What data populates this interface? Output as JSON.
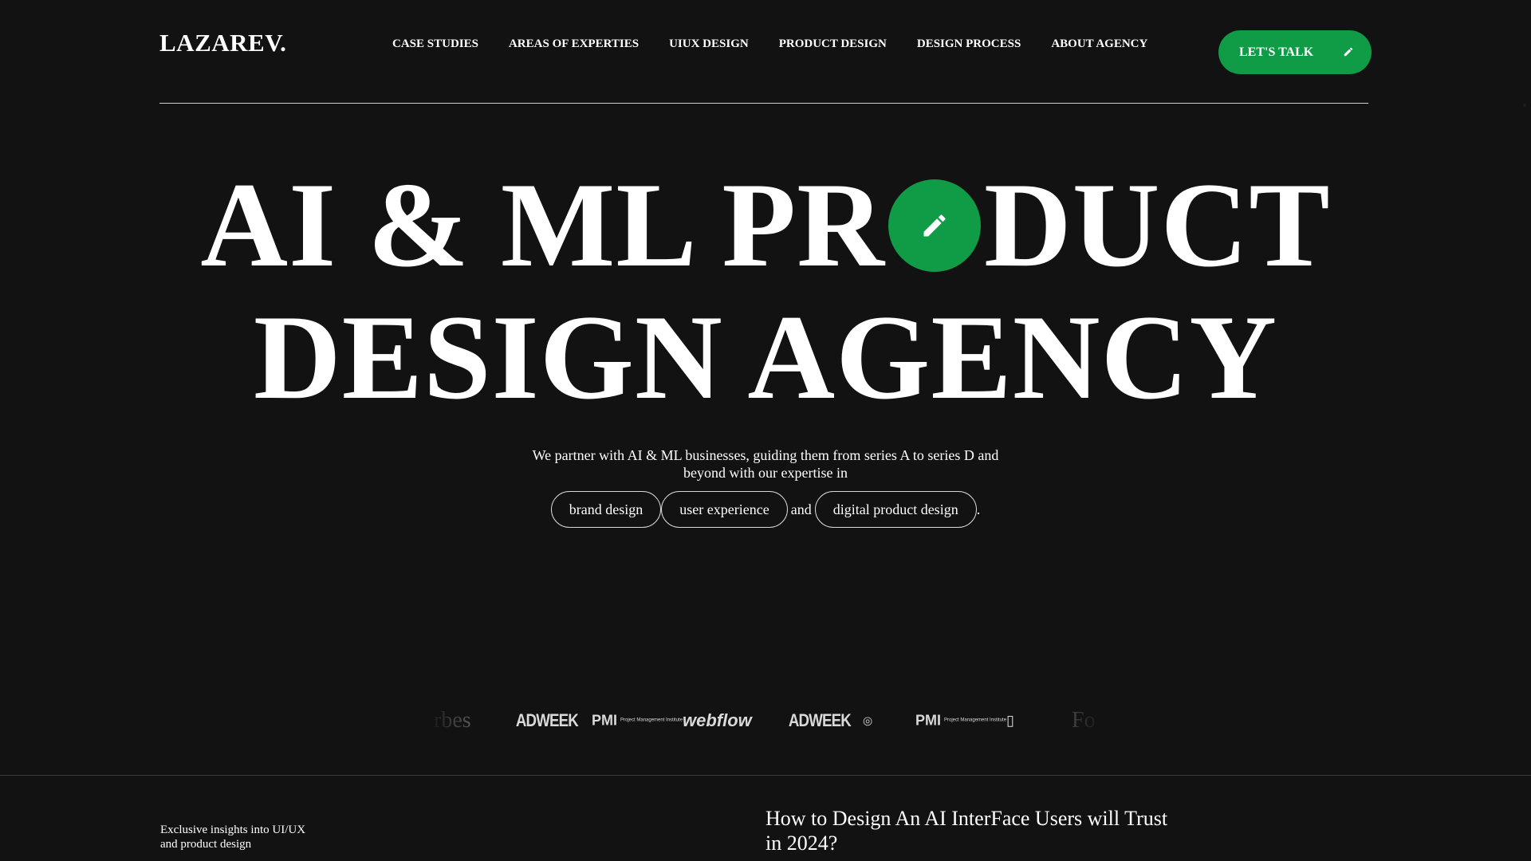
{
  "brand": {
    "logo": "LAZAREV."
  },
  "nav": {
    "items": [
      {
        "label": "CASE STUDIES"
      },
      {
        "label": "AREAS OF EXPERTIES"
      },
      {
        "label": "UIUX DESIGN"
      },
      {
        "label": "PRODUCT DESIGN"
      },
      {
        "label": "DESIGN PROCESS"
      },
      {
        "label": "ABOUT AGENCY"
      }
    ],
    "cta_label": "LET'S TALK"
  },
  "hero": {
    "line1_before_o": "AI & ML PR",
    "line1_after_o": "DUCT",
    "line2": "DESIGN AGENCY",
    "subtitle": "We partner with AI & ML businesses, guiding them from series A to series D and beyond with our expertise in",
    "chips": [
      "brand design",
      "user experience",
      "digital product design"
    ],
    "chip_joiner": "and",
    "chip_end": "."
  },
  "logos": {
    "items": [
      {
        "name": "forbes",
        "text": "rbes"
      },
      {
        "name": "adweek",
        "text": "ADWEEK"
      },
      {
        "name": "pmi",
        "text": "PMI",
        "sub": "Project Management Institute"
      },
      {
        "name": "webflow",
        "text": "webflow"
      },
      {
        "name": "adweek",
        "text": "ADWEEK"
      },
      {
        "name": "small-globe",
        "text": "◎"
      },
      {
        "name": "pmi",
        "text": "PMI",
        "sub": "Project Management Institute"
      },
      {
        "name": "small-mark",
        "text": "▯"
      },
      {
        "name": "forbes",
        "text": "Fo"
      }
    ]
  },
  "insights": {
    "label": "Exclusive insights into UI/UX and product design",
    "article_title": "How to Design An AI InterFace Users will Trust in 2024?"
  },
  "colors": {
    "background": "#121212",
    "accent": "#109b46",
    "text": "#ffffff"
  },
  "icons": {
    "cta_icon": "pencil-icon",
    "hero_o_icon": "pencil-icon"
  }
}
